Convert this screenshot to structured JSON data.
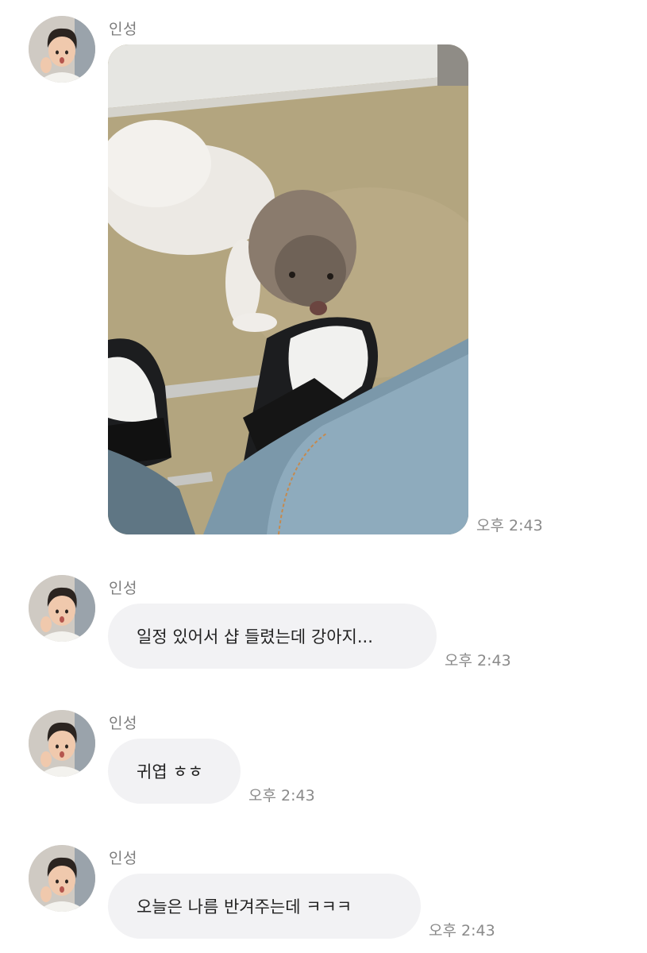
{
  "messages": [
    {
      "sender": "인성",
      "type": "image",
      "image_alt": "dog-and-sneakers-photo",
      "time": "오후 2:43"
    },
    {
      "sender": "인성",
      "type": "text",
      "text": "일정 있어서 샵 들렸는데 강아지...",
      "time": "오후 2:43"
    },
    {
      "sender": "인성",
      "type": "text",
      "text": "귀엽 ㅎㅎ",
      "time": "오후 2:43"
    },
    {
      "sender": "인성",
      "type": "text",
      "text": "오늘은 나름 반겨주는데 ㅋㅋㅋ",
      "time": "오후 2:43"
    }
  ],
  "colors": {
    "background": "#ffffff",
    "bubble": "#f2f2f4",
    "sender_text": "#7d7d7d",
    "time_text": "#8a8a8a"
  }
}
